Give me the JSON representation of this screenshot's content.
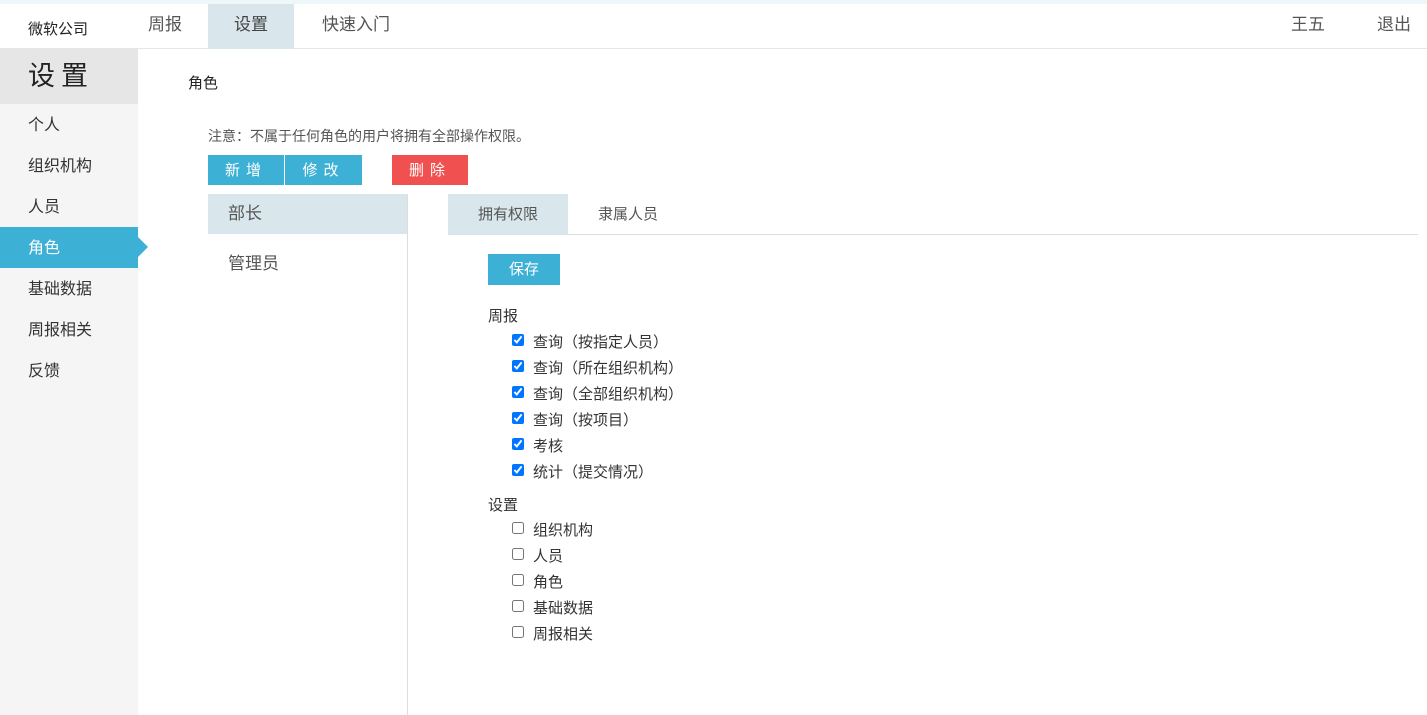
{
  "header": {
    "brand": "微软公司",
    "nav": [
      {
        "label": "周报",
        "active": false
      },
      {
        "label": "设置",
        "active": true
      },
      {
        "label": "快速入门",
        "active": false
      }
    ],
    "user": "王五",
    "logout": "退出"
  },
  "sidebar": {
    "title": "设置",
    "items": [
      {
        "label": "个人"
      },
      {
        "label": "组织机构"
      },
      {
        "label": "人员"
      },
      {
        "label": "角色",
        "active": true
      },
      {
        "label": "基础数据"
      },
      {
        "label": "周报相关"
      },
      {
        "label": "反馈"
      }
    ]
  },
  "main": {
    "title": "角色",
    "notice": "注意：不属于任何角色的用户将拥有全部操作权限。",
    "buttons": {
      "add": "新增",
      "edit": "修改",
      "delete": "删除",
      "save": "保存"
    },
    "roles": [
      {
        "label": "部长",
        "active": true
      },
      {
        "label": "管理员",
        "active": false
      }
    ],
    "tabs": [
      {
        "label": "拥有权限",
        "active": true
      },
      {
        "label": "隶属人员",
        "active": false
      }
    ],
    "groups": [
      {
        "title": "周报",
        "perms": [
          {
            "label": "查询（按指定人员）",
            "checked": true
          },
          {
            "label": "查询（所在组织机构）",
            "checked": true
          },
          {
            "label": "查询（全部组织机构）",
            "checked": true
          },
          {
            "label": "查询（按项目）",
            "checked": true
          },
          {
            "label": "考核",
            "checked": true
          },
          {
            "label": "统计（提交情况）",
            "checked": true
          }
        ]
      },
      {
        "title": "设置",
        "perms": [
          {
            "label": "组织机构",
            "checked": false
          },
          {
            "label": "人员",
            "checked": false
          },
          {
            "label": "角色",
            "checked": false
          },
          {
            "label": "基础数据",
            "checked": false
          },
          {
            "label": "周报相关",
            "checked": false
          }
        ]
      }
    ]
  },
  "colors": {
    "accent": "#3db0d6",
    "danger": "#f05050",
    "selected": "#d9e6ec"
  }
}
